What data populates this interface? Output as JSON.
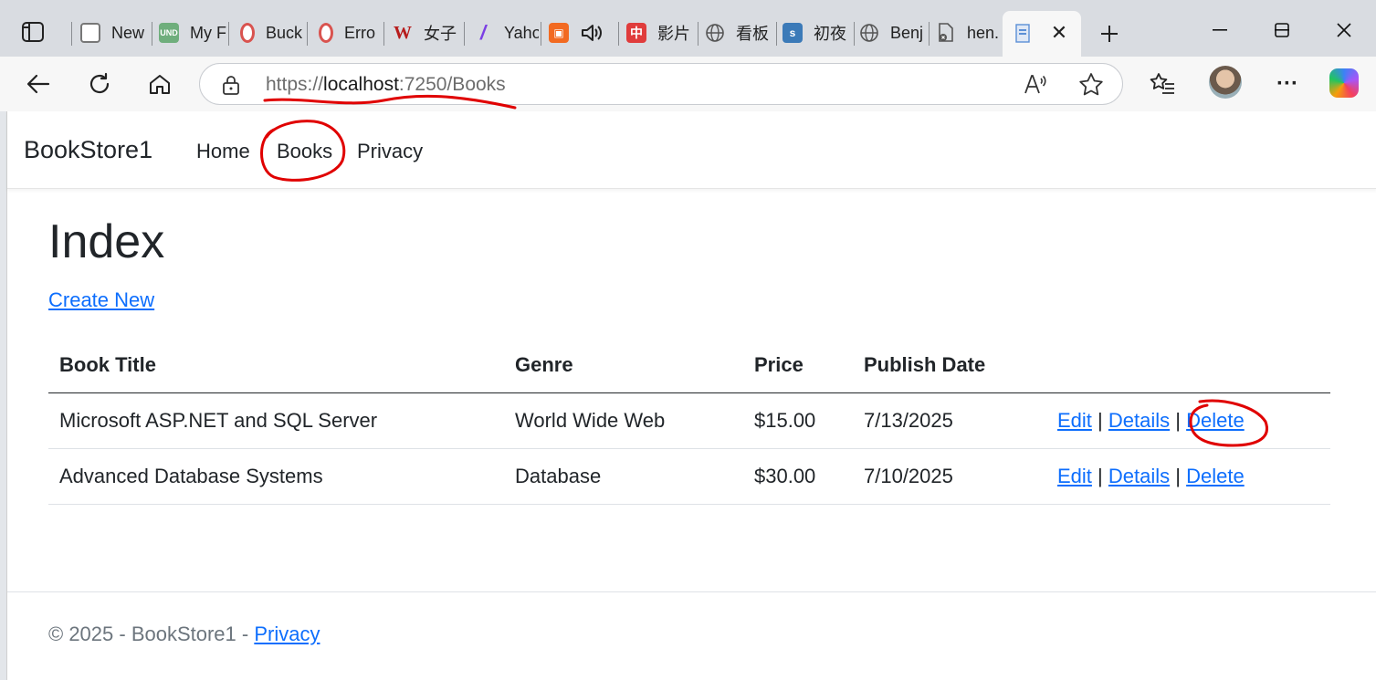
{
  "browser": {
    "tabs": [
      {
        "title": "New",
        "icon": "page-icon",
        "color": "#ffffff"
      },
      {
        "title": "My F",
        "icon": "und-icon",
        "color": "#6fae7c",
        "glyph": "UND"
      },
      {
        "title": "Buck",
        "icon": "opera-icon",
        "color": "#d9534f"
      },
      {
        "title": "Erro",
        "icon": "opera-icon",
        "color": "#d9534f"
      },
      {
        "title": "女子",
        "icon": "w-logo-icon",
        "color": "#b71c1c",
        "glyph": "W"
      },
      {
        "title": "Yaho",
        "icon": "yahoo-icon",
        "color": "#7b3fe4",
        "glyph": "/"
      },
      {
        "title": "",
        "icon": "notification-icon",
        "color": "#f26a21",
        "glyph": "•"
      },
      {
        "title": "影片",
        "icon": "brand-icon",
        "color": "#e03c3c",
        "glyph": "中"
      },
      {
        "title": "看板",
        "icon": "globe-icon",
        "color": "#666666"
      },
      {
        "title": "初夜",
        "icon": "app-icon",
        "color": "#3b7ab8",
        "glyph": "s"
      },
      {
        "title": "Benj",
        "icon": "globe-icon",
        "color": "#666666"
      },
      {
        "title": "hen.",
        "icon": "file-error-icon",
        "color": "#666666"
      },
      {
        "title": "",
        "icon": "document-icon",
        "color": "#5b8fd6",
        "active": true
      }
    ],
    "address": {
      "scheme": "https://",
      "host": "localhost",
      "rest": ":7250/Books"
    }
  },
  "site": {
    "brand": "BookStore1",
    "nav": [
      "Home",
      "Books",
      "Privacy"
    ]
  },
  "page": {
    "title": "Index",
    "create_new": "Create New",
    "table": {
      "headers": [
        "Book Title",
        "Genre",
        "Price",
        "Publish Date"
      ],
      "rows": [
        {
          "title": "Microsoft ASP.NET and SQL Server",
          "genre": "World Wide Web",
          "price": "$15.00",
          "date": "7/13/2025"
        },
        {
          "title": "Advanced Database Systems",
          "genre": "Database",
          "price": "$30.00",
          "date": "7/10/2025"
        }
      ],
      "actions": {
        "edit": "Edit",
        "details": "Details",
        "delete": "Delete",
        "separator": "|"
      }
    }
  },
  "footer": {
    "copyright": "© 2025 - BookStore1 - ",
    "privacy": "Privacy"
  },
  "colors": {
    "link": "#0d6efd",
    "annotation": "#e00000"
  }
}
